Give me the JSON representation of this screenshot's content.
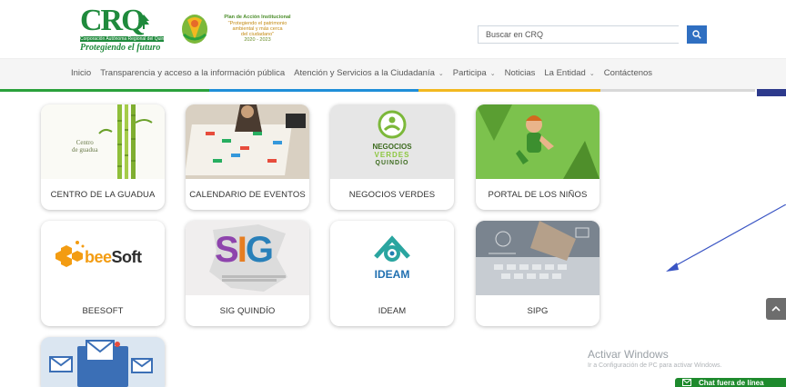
{
  "header": {
    "logo_main": "CRQ",
    "logo_sub": "Corporación Autónoma Regional del Quindío",
    "logo_tagline": "Protegiendo el futuro",
    "plan_lines": [
      "Plan de Acción Institucional",
      "\"Protegiendo el patrimonio",
      "ambiental y más cerca",
      "del ciudadano\"",
      "2020 - 2023"
    ],
    "search_placeholder": "Buscar en CRQ",
    "search_icon": "search-icon"
  },
  "nav": {
    "items": [
      {
        "label": "Inicio",
        "dropdown": false
      },
      {
        "label": "Transparencia y acceso a la información pública",
        "dropdown": false
      },
      {
        "label": "Atención y Servicios a la Ciudadanía",
        "dropdown": true
      },
      {
        "label": "Participa",
        "dropdown": true
      },
      {
        "label": "Noticias",
        "dropdown": false
      },
      {
        "label": "La Entidad",
        "dropdown": true
      },
      {
        "label": "Contáctenos",
        "dropdown": false
      }
    ],
    "chevron": "⌄"
  },
  "cards": [
    {
      "label": "CENTRO DE LA GUADUA",
      "img_text": [
        "Centro",
        "de guadua"
      ]
    },
    {
      "label": "CALENDARIO DE EVENTOS"
    },
    {
      "label": "NEGOCIOS VERDES",
      "img_text": [
        "NEGOCIOS",
        "VERDES",
        "QUINDÍO"
      ]
    },
    {
      "label": "PORTAL DE LOS NIÑOS"
    },
    {
      "label": "BEESOFT",
      "img_text": [
        "beeSoft"
      ]
    },
    {
      "label": "SIG QUINDÍO",
      "img_text": [
        "SIG"
      ]
    },
    {
      "label": "IDEAM",
      "img_text": [
        "IDEAM"
      ]
    },
    {
      "label": "SIPG"
    },
    {
      "label": ""
    }
  ],
  "overlay": {
    "activate_title": "Activar Windows",
    "activate_sub": "Ir a Configuración de PC para activar Windows.",
    "chat_label": "Chat fuera de línea",
    "up_icon": "chevron-up-icon"
  },
  "colors": {
    "brand_green": "#1f8a3c",
    "brand_blue": "#2f6fc1",
    "stripe": [
      "#2aa13b",
      "#1f8ed8",
      "#f2b820",
      "#d8d8d8"
    ],
    "chat_green": "#1e8a2d"
  }
}
